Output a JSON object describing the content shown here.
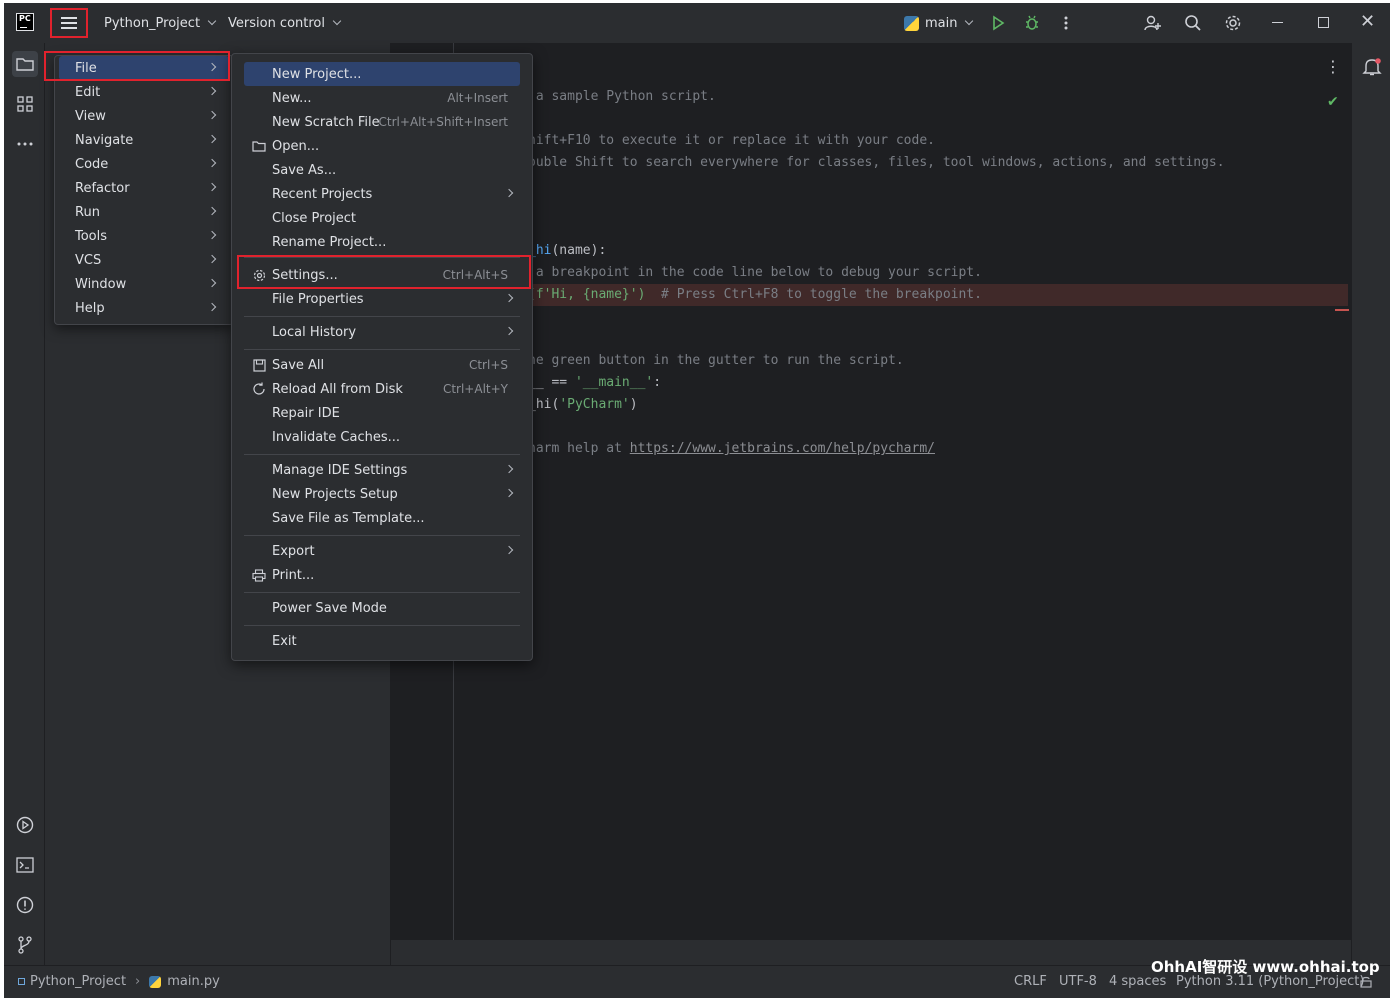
{
  "titlebar": {
    "logo": "PC",
    "project_name": "Python_Project",
    "vcs_label": "Version control",
    "branch": "main",
    "icons": [
      "hamburger-icon",
      "run-icon",
      "debug-icon",
      "more-icon",
      "add-user-icon",
      "search-icon",
      "gear-icon"
    ]
  },
  "main_menu": {
    "items": [
      {
        "label": "File"
      },
      {
        "label": "Edit"
      },
      {
        "label": "View"
      },
      {
        "label": "Navigate"
      },
      {
        "label": "Code"
      },
      {
        "label": "Refactor"
      },
      {
        "label": "Run"
      },
      {
        "label": "Tools"
      },
      {
        "label": "VCS"
      },
      {
        "label": "Window"
      },
      {
        "label": "Help"
      }
    ]
  },
  "file_menu": {
    "items": [
      {
        "label": "New Project...",
        "shortcut": ""
      },
      {
        "label": "New...",
        "shortcut": "Alt+Insert"
      },
      {
        "label": "New Scratch File",
        "shortcut": "Ctrl+Alt+Shift+Insert"
      },
      {
        "label": "Open...",
        "shortcut": ""
      },
      {
        "label": "Save As...",
        "shortcut": ""
      },
      {
        "label": "Recent Projects",
        "shortcut": ""
      },
      {
        "label": "Close Project",
        "shortcut": ""
      },
      {
        "label": "Rename Project...",
        "shortcut": ""
      },
      {
        "label": "Settings...",
        "shortcut": "Ctrl+Alt+S"
      },
      {
        "label": "File Properties",
        "shortcut": ""
      },
      {
        "label": "Local History",
        "shortcut": ""
      },
      {
        "label": "Save All",
        "shortcut": "Ctrl+S"
      },
      {
        "label": "Reload All from Disk",
        "shortcut": "Ctrl+Alt+Y"
      },
      {
        "label": "Repair IDE",
        "shortcut": ""
      },
      {
        "label": "Invalidate Caches...",
        "shortcut": ""
      },
      {
        "label": "Manage IDE Settings",
        "shortcut": ""
      },
      {
        "label": "New Projects Setup",
        "shortcut": ""
      },
      {
        "label": "Save File as Template...",
        "shortcut": ""
      },
      {
        "label": "Export",
        "shortcut": ""
      },
      {
        "label": "Print...",
        "shortcut": ""
      },
      {
        "label": "Power Save Mode",
        "shortcut": ""
      },
      {
        "label": "Exit",
        "shortcut": ""
      }
    ]
  },
  "editor": {
    "lines": [
      " a sample Python script.",
      "hift+F10 to execute it or replace it with your code.",
      "ouble Shift to search everywhere for classes, files, tool windows, actions, and settings.",
      "_hi",
      "(name):",
      " a breakpoint in the code line below to debug your script.",
      "(f'Hi, {name}')",
      "  # Press Ctrl+F8 to toggle the breakpoint.",
      "he green button in the gutter to run the script.",
      "__ == ",
      "'__main__'",
      ":",
      "_hi(",
      "'PyCharm'",
      ")",
      "harm help at ",
      "https://www.jetbrains.com/help/pycharm/"
    ]
  },
  "statusbar": {
    "breadcrumb_project": "Python_Project",
    "breadcrumb_file": "main.py",
    "line_sep": "CRLF",
    "encoding": "UTF-8",
    "indent": "4 spaces",
    "interpreter": "Python 3.11 (Python_Project)",
    "watermark": "OhhAI智研设  www.ohhai.top"
  },
  "colors": {
    "accent": "#2e436e",
    "highlight": "#e0222d",
    "background": "#1e1f22",
    "panel": "#2b2d30"
  }
}
